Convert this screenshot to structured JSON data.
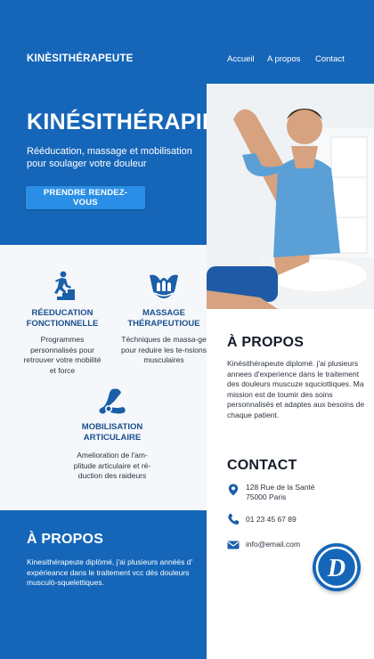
{
  "header": {
    "brand": "KINÈSITHÉRAPEUTE",
    "nav": [
      "Accueil",
      "A propos",
      "Contact"
    ]
  },
  "hero": {
    "title": "KINÉSITHÉRAPIE",
    "subtitle": "Rééducation, massage et mobilisation pour soulager votre douleur",
    "cta": "PRENDRE RENDEZ-VOUS"
  },
  "features": [
    {
      "icon": "stairs-person-icon",
      "title": "RÉEDUCATION FONCTIONNELLE",
      "desc": "Programmes personnalisés pour retrouver votre mobilité et force"
    },
    {
      "icon": "massage-hands-icon",
      "title": "MASSAGE THÉRAPEUTIOUE",
      "desc": "Téchniques de massa-ge pour reduire les te-nsions musculaires"
    },
    {
      "icon": "joint-mobilization-icon",
      "title": "MOBILISATION ARTICULAIRE",
      "desc": "Amelioration de l'am-plitude articulaire et ré-duction des raideurs"
    }
  ],
  "about_right": {
    "heading": "À PROPOS",
    "text": "Kinésithérapeute diplomé. j'ai plusieurs annees d'experience dans le traitement des douleurs muscuze squciottiques. Ma mission est de toumir des soins personnalisés et adaptes aux besoins de chaque patient."
  },
  "contact": {
    "heading": "CONTACT",
    "address_line1": "128 Rue de la Santé",
    "address_line2": "75000 Paris",
    "phone": "01 23 45 67 89",
    "email": "info@email.com"
  },
  "about_bottom": {
    "heading": "À PROPOS",
    "text": "Kinesithérapeute diplòmé, j'ai plusieurs annéés d' expérieance dans le traitement vcc dés douleurs musculò-squelettiques."
  },
  "logo_letter": "D",
  "colors": {
    "primary": "#1566b8",
    "button": "#2a8ee6",
    "feature_title": "#1a4f8f",
    "icon": "#1a5fa8"
  }
}
